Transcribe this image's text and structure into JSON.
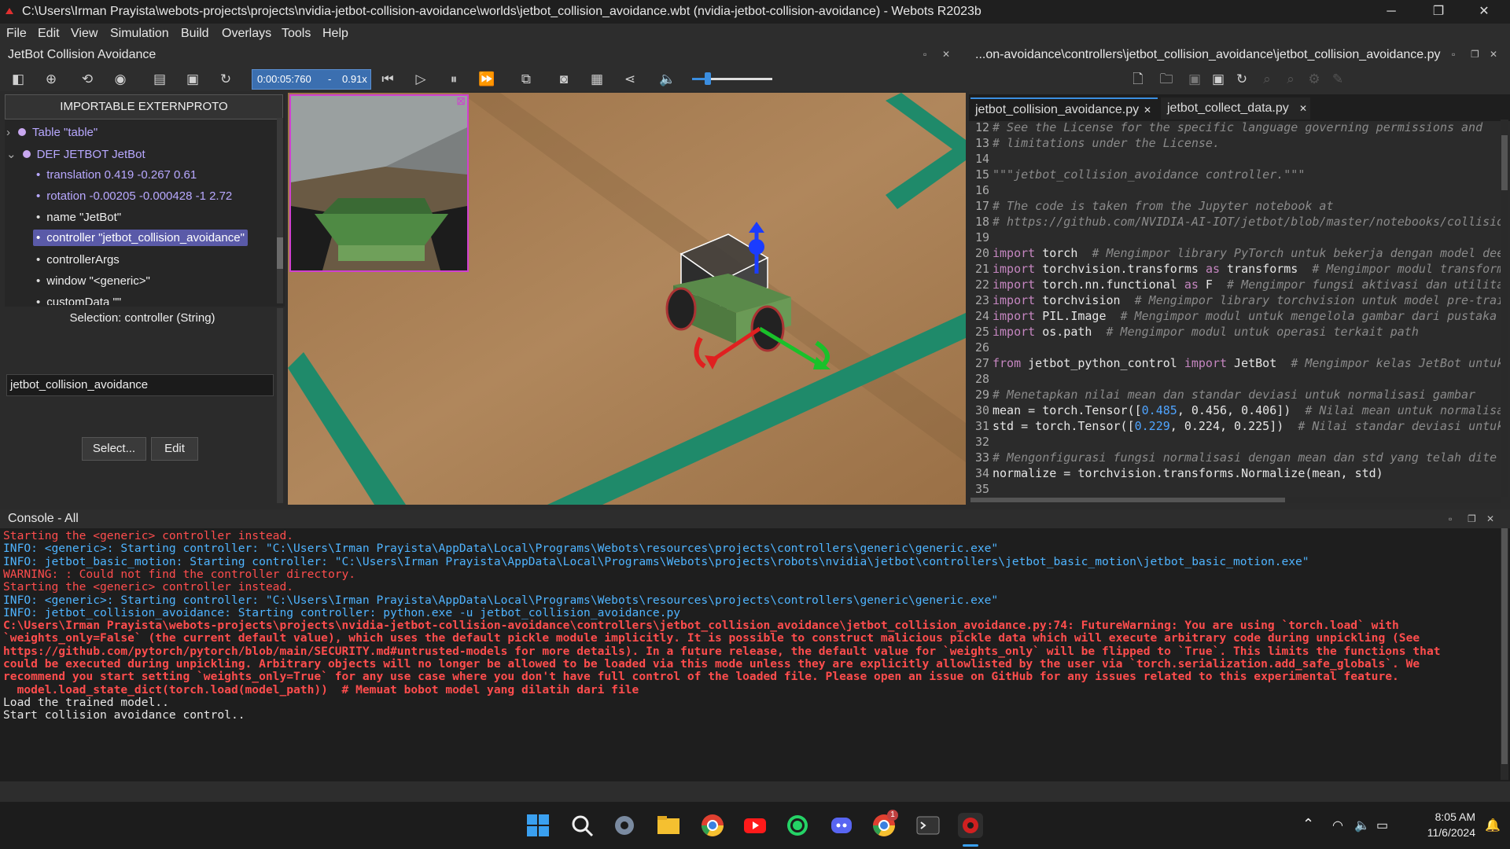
{
  "window": {
    "title": "C:\\Users\\Irman Prayista\\webots-projects\\projects\\nvidia-jetbot-collision-avoidance\\worlds\\jetbot_collision_avoidance.wbt (nvidia-jetbot-collision-avoidance) - Webots R2023b",
    "minimize": "─",
    "restore": "❐",
    "close": "✕"
  },
  "menu": [
    "File",
    "Edit",
    "View",
    "Simulation",
    "Build",
    "Overlays",
    "Tools",
    "Help"
  ],
  "left_panel": {
    "title": "JetBot Collision Avoidance",
    "import_button": "IMPORTABLE EXTERNPROTO",
    "tree": [
      {
        "text": "Table \"table\"",
        "expander": "›"
      },
      {
        "text": "DEF JETBOT JetBot",
        "expander": "⌄"
      },
      {
        "text": "translation 0.419 -0.267 0.61"
      },
      {
        "text": "rotation -0.00205 -0.000428 -1 2.72"
      },
      {
        "text": "name \"JetBot\""
      },
      {
        "text": "controller \"jetbot_collision_avoidance\""
      },
      {
        "text": "controllerArgs"
      },
      {
        "text": "window \"<generic>\""
      },
      {
        "text": "customData \"\""
      }
    ],
    "selection_label": "Selection: controller (String)",
    "selection_value": "jetbot_collision_avoidance",
    "select_button": "Select...",
    "edit_button": "Edit"
  },
  "toolbar": {
    "time": "0:00:05:760",
    "speed": "0.91x",
    "speed_separator": "-",
    "volume_level": 0.2
  },
  "editor": {
    "path": "...on-avoidance\\controllers\\jetbot_collision_avoidance\\jetbot_collision_avoidance.py",
    "tabs": [
      "jetbot_collision_avoidance.py",
      "jetbot_collect_data.py"
    ],
    "tab_close": "✕",
    "lines": [
      {
        "n": "12",
        "parts": [
          {
            "c": "cm",
            "t": "# See the License for the specific language governing permissions and"
          }
        ]
      },
      {
        "n": "13",
        "parts": [
          {
            "c": "cm",
            "t": "# limitations under the License."
          }
        ]
      },
      {
        "n": "14",
        "parts": []
      },
      {
        "n": "15",
        "parts": [
          {
            "c": "cm",
            "t": "\"\"\"jetbot_collision_avoidance controller.\"\"\""
          }
        ]
      },
      {
        "n": "16",
        "parts": []
      },
      {
        "n": "17",
        "parts": [
          {
            "c": "cm",
            "t": "# The code is taken from the Jupyter notebook at"
          }
        ]
      },
      {
        "n": "18",
        "parts": [
          {
            "c": "cm",
            "t": "# https://github.com/NVIDIA-AI-IOT/jetbot/blob/master/notebooks/collisio"
          }
        ]
      },
      {
        "n": "19",
        "parts": []
      },
      {
        "n": "20",
        "parts": [
          {
            "c": "kw",
            "t": "import"
          },
          {
            "c": "tx",
            "t": " torch  "
          },
          {
            "c": "cm",
            "t": "# Mengimpor library PyTorch untuk bekerja dengan model dee"
          }
        ]
      },
      {
        "n": "21",
        "parts": [
          {
            "c": "kw",
            "t": "import"
          },
          {
            "c": "tx",
            "t": " torchvision.transforms "
          },
          {
            "c": "kw",
            "t": "as"
          },
          {
            "c": "tx",
            "t": " transforms  "
          },
          {
            "c": "cm",
            "t": "# Mengimpor modul transform"
          }
        ]
      },
      {
        "n": "22",
        "parts": [
          {
            "c": "kw",
            "t": "import"
          },
          {
            "c": "tx",
            "t": " torch.nn.functional "
          },
          {
            "c": "kw",
            "t": "as"
          },
          {
            "c": "tx",
            "t": " F  "
          },
          {
            "c": "cm",
            "t": "# Mengimpor fungsi aktivasi dan utilita"
          }
        ]
      },
      {
        "n": "23",
        "parts": [
          {
            "c": "kw",
            "t": "import"
          },
          {
            "c": "tx",
            "t": " torchvision  "
          },
          {
            "c": "cm",
            "t": "# Mengimpor library torchvision untuk model pre-trai"
          }
        ]
      },
      {
        "n": "24",
        "parts": [
          {
            "c": "kw",
            "t": "import"
          },
          {
            "c": "tx",
            "t": " PIL.Image  "
          },
          {
            "c": "cm",
            "t": "# Mengimpor modul untuk mengelola gambar dari pustaka P"
          }
        ]
      },
      {
        "n": "25",
        "parts": [
          {
            "c": "kw",
            "t": "import"
          },
          {
            "c": "tx",
            "t": " os.path  "
          },
          {
            "c": "cm",
            "t": "# Mengimpor modul untuk operasi terkait path"
          }
        ]
      },
      {
        "n": "26",
        "parts": []
      },
      {
        "n": "27",
        "parts": [
          {
            "c": "kw",
            "t": "from"
          },
          {
            "c": "tx",
            "t": " jetbot_python_control "
          },
          {
            "c": "kw",
            "t": "import"
          },
          {
            "c": "tx",
            "t": " JetBot  "
          },
          {
            "c": "cm",
            "t": "# Mengimpor kelas JetBot untuk"
          }
        ]
      },
      {
        "n": "28",
        "parts": []
      },
      {
        "n": "29",
        "parts": [
          {
            "c": "cm",
            "t": "# Menetapkan nilai mean dan standar deviasi untuk normalisasi gambar"
          }
        ]
      },
      {
        "n": "30",
        "parts": [
          {
            "c": "tx",
            "t": "mean = torch.Tensor(["
          },
          {
            "c": "num",
            "t": "0.485"
          },
          {
            "c": "tx",
            "t": ", 0.456, 0.406])  "
          },
          {
            "c": "cm",
            "t": "# Nilai mean untuk normalisa"
          }
        ]
      },
      {
        "n": "31",
        "parts": [
          {
            "c": "tx",
            "t": "std = torch.Tensor(["
          },
          {
            "c": "num",
            "t": "0.229"
          },
          {
            "c": "tx",
            "t": ", 0.224, 0.225])  "
          },
          {
            "c": "cm",
            "t": "# Nilai standar deviasi untuk"
          }
        ]
      },
      {
        "n": "32",
        "parts": []
      },
      {
        "n": "33",
        "parts": [
          {
            "c": "cm",
            "t": "# Mengonfigurasi fungsi normalisasi dengan mean dan std yang telah dite"
          }
        ]
      },
      {
        "n": "34",
        "parts": [
          {
            "c": "tx",
            "t": "normalize = torchvision.transforms.Normalize(mean, std)"
          }
        ]
      },
      {
        "n": "35",
        "parts": []
      }
    ]
  },
  "console": {
    "title": "Console - All",
    "lines": [
      {
        "c": "err",
        "t": "Starting the <generic> controller instead."
      },
      {
        "c": "info",
        "t": "INFO: <generic>: Starting controller: \"C:\\Users\\Irman Prayista\\AppData\\Local\\Programs\\Webots\\resources\\projects\\controllers\\generic\\generic.exe\""
      },
      {
        "c": "info",
        "t": "INFO: jetbot_basic_motion: Starting controller: \"C:\\Users\\Irman Prayista\\AppData\\Local\\Programs\\Webots\\projects\\robots\\nvidia\\jetbot\\controllers\\jetbot_basic_motion\\jetbot_basic_motion.exe\""
      },
      {
        "c": "warn",
        "t": "WARNING: : Could not find the controller directory."
      },
      {
        "c": "err",
        "t": "Starting the <generic> controller instead."
      },
      {
        "c": "info",
        "t": "INFO: <generic>: Starting controller: \"C:\\Users\\Irman Prayista\\AppData\\Local\\Programs\\Webots\\resources\\projects\\controllers\\generic\\generic.exe\""
      },
      {
        "c": "info",
        "t": "INFO: jetbot_collision_avoidance: Starting controller: python.exe -u jetbot_collision_avoidance.py"
      },
      {
        "c": "err bold",
        "t": "C:\\Users\\Irman Prayista\\webots-projects\\projects\\nvidia-jetbot-collision-avoidance\\controllers\\jetbot_collision_avoidance\\jetbot_collision_avoidance.py:74: FutureWarning: You are using `torch.load` with"
      },
      {
        "c": "err bold",
        "t": "`weights_only=False` (the current default value), which uses the default pickle module implicitly. It is possible to construct malicious pickle data which will execute arbitrary code during unpickling (See"
      },
      {
        "c": "err bold",
        "t": "https://github.com/pytorch/pytorch/blob/main/SECURITY.md#untrusted-models for more details). In a future release, the default value for `weights_only` will be flipped to `True`. This limits the functions that"
      },
      {
        "c": "err bold",
        "t": "could be executed during unpickling. Arbitrary objects will no longer be allowed to be loaded via this mode unless they are explicitly allowlisted by the user via `torch.serialization.add_safe_globals`. We"
      },
      {
        "c": "err bold",
        "t": "recommend you start setting `weights_only=True` for any use case where you don't have full control of the loaded file. Please open an issue on GitHub for any issues related to this experimental feature."
      },
      {
        "c": "err bold",
        "t": "  model.load_state_dict(torch.load(model_path))  # Memuat bobot model yang dilatih dari file"
      },
      {
        "c": "norm",
        "t": "Load the trained model.."
      },
      {
        "c": "norm",
        "t": "Start collision avoidance control.."
      }
    ]
  },
  "taskbar": {
    "time": "8:05 AM",
    "date": "11/6/2024",
    "chrome_badge": "1",
    "tray_caret": "⌃"
  },
  "panel_buttons": {
    "float": "▫",
    "close": "✕",
    "restore": "❐"
  },
  "colors": {
    "accent": "#3b6fb0",
    "selection": "#5a5aa8",
    "error": "#ff4d4d",
    "info": "#4fb4ff"
  }
}
